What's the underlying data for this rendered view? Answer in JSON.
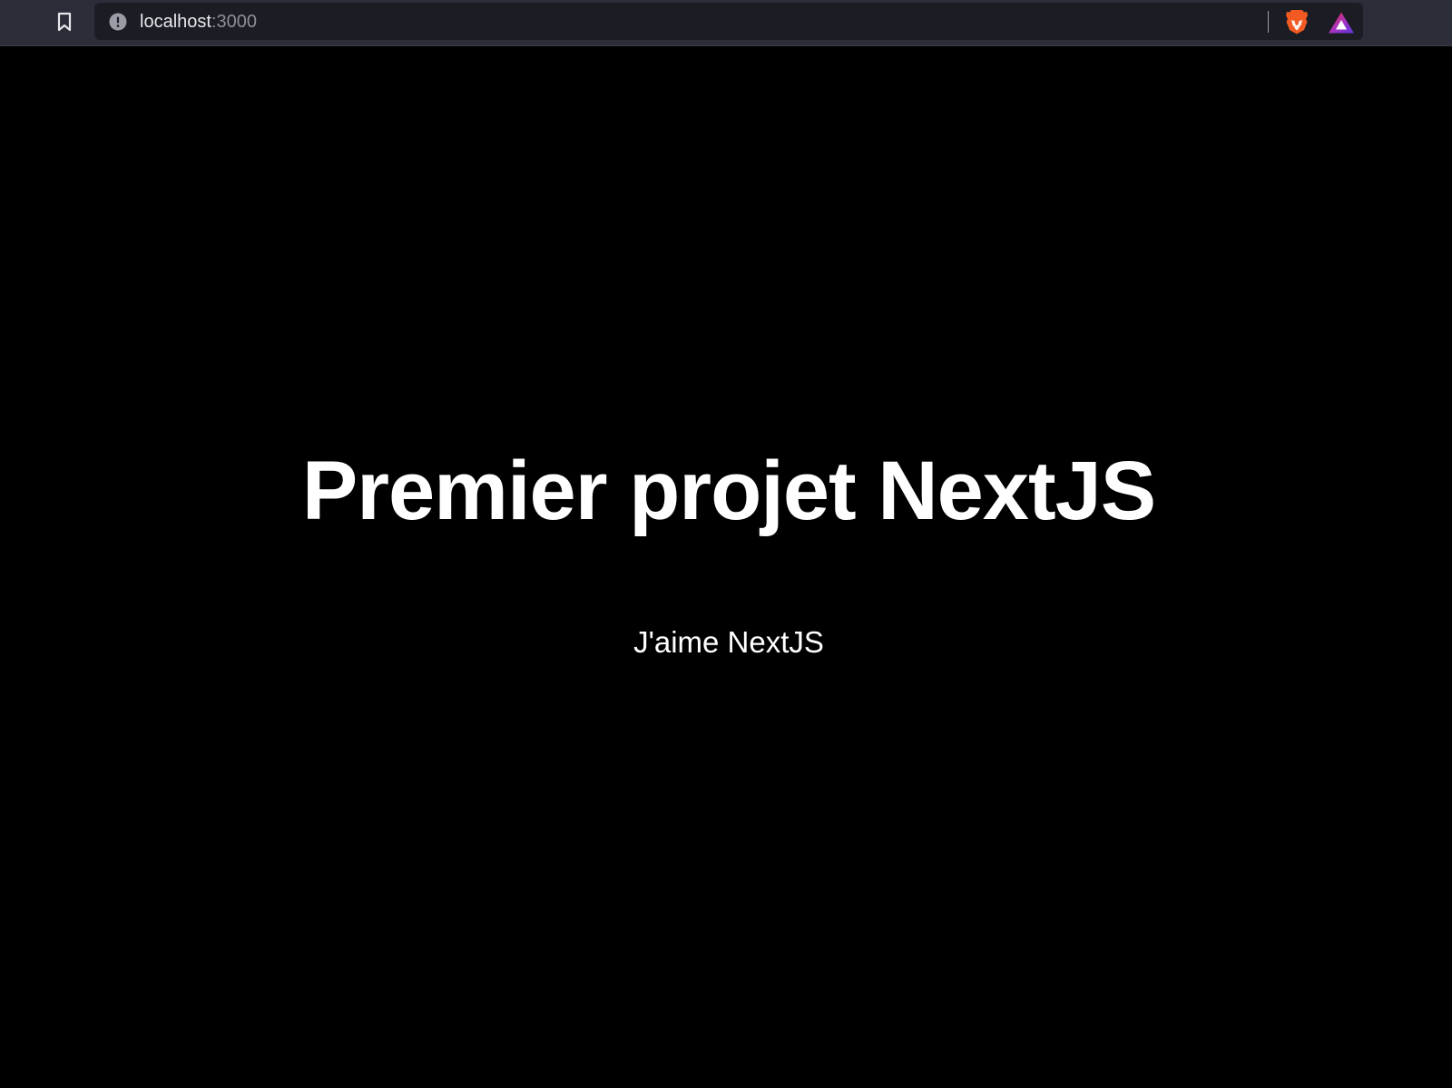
{
  "browser": {
    "toolbar_color": "#2b2d39",
    "urlbar_color": "#1b1c24",
    "url": {
      "host": "localhost",
      "port": ":3000"
    },
    "icons": {
      "bookmark": "bookmark-icon",
      "site_info": "info-circle-icon",
      "brave_shields": "brave-lion-icon",
      "brave_rewards": "rewards-triangle-icon"
    }
  },
  "page": {
    "background": "#000000",
    "headline": "Premier projet NextJS",
    "subtitle": "J'aime NextJS"
  }
}
